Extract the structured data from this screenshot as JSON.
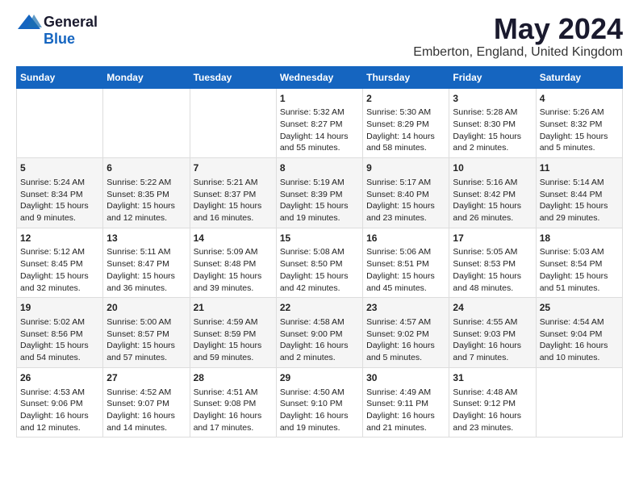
{
  "logo": {
    "general": "General",
    "blue": "Blue"
  },
  "title": "May 2024",
  "subtitle": "Emberton, England, United Kingdom",
  "days_of_week": [
    "Sunday",
    "Monday",
    "Tuesday",
    "Wednesday",
    "Thursday",
    "Friday",
    "Saturday"
  ],
  "weeks": [
    [
      {
        "day": "",
        "content": ""
      },
      {
        "day": "",
        "content": ""
      },
      {
        "day": "",
        "content": ""
      },
      {
        "day": "1",
        "content": "Sunrise: 5:32 AM\nSunset: 8:27 PM\nDaylight: 14 hours\nand 55 minutes."
      },
      {
        "day": "2",
        "content": "Sunrise: 5:30 AM\nSunset: 8:29 PM\nDaylight: 14 hours\nand 58 minutes."
      },
      {
        "day": "3",
        "content": "Sunrise: 5:28 AM\nSunset: 8:30 PM\nDaylight: 15 hours\nand 2 minutes."
      },
      {
        "day": "4",
        "content": "Sunrise: 5:26 AM\nSunset: 8:32 PM\nDaylight: 15 hours\nand 5 minutes."
      }
    ],
    [
      {
        "day": "5",
        "content": "Sunrise: 5:24 AM\nSunset: 8:34 PM\nDaylight: 15 hours\nand 9 minutes."
      },
      {
        "day": "6",
        "content": "Sunrise: 5:22 AM\nSunset: 8:35 PM\nDaylight: 15 hours\nand 12 minutes."
      },
      {
        "day": "7",
        "content": "Sunrise: 5:21 AM\nSunset: 8:37 PM\nDaylight: 15 hours\nand 16 minutes."
      },
      {
        "day": "8",
        "content": "Sunrise: 5:19 AM\nSunset: 8:39 PM\nDaylight: 15 hours\nand 19 minutes."
      },
      {
        "day": "9",
        "content": "Sunrise: 5:17 AM\nSunset: 8:40 PM\nDaylight: 15 hours\nand 23 minutes."
      },
      {
        "day": "10",
        "content": "Sunrise: 5:16 AM\nSunset: 8:42 PM\nDaylight: 15 hours\nand 26 minutes."
      },
      {
        "day": "11",
        "content": "Sunrise: 5:14 AM\nSunset: 8:44 PM\nDaylight: 15 hours\nand 29 minutes."
      }
    ],
    [
      {
        "day": "12",
        "content": "Sunrise: 5:12 AM\nSunset: 8:45 PM\nDaylight: 15 hours\nand 32 minutes."
      },
      {
        "day": "13",
        "content": "Sunrise: 5:11 AM\nSunset: 8:47 PM\nDaylight: 15 hours\nand 36 minutes."
      },
      {
        "day": "14",
        "content": "Sunrise: 5:09 AM\nSunset: 8:48 PM\nDaylight: 15 hours\nand 39 minutes."
      },
      {
        "day": "15",
        "content": "Sunrise: 5:08 AM\nSunset: 8:50 PM\nDaylight: 15 hours\nand 42 minutes."
      },
      {
        "day": "16",
        "content": "Sunrise: 5:06 AM\nSunset: 8:51 PM\nDaylight: 15 hours\nand 45 minutes."
      },
      {
        "day": "17",
        "content": "Sunrise: 5:05 AM\nSunset: 8:53 PM\nDaylight: 15 hours\nand 48 minutes."
      },
      {
        "day": "18",
        "content": "Sunrise: 5:03 AM\nSunset: 8:54 PM\nDaylight: 15 hours\nand 51 minutes."
      }
    ],
    [
      {
        "day": "19",
        "content": "Sunrise: 5:02 AM\nSunset: 8:56 PM\nDaylight: 15 hours\nand 54 minutes."
      },
      {
        "day": "20",
        "content": "Sunrise: 5:00 AM\nSunset: 8:57 PM\nDaylight: 15 hours\nand 57 minutes."
      },
      {
        "day": "21",
        "content": "Sunrise: 4:59 AM\nSunset: 8:59 PM\nDaylight: 15 hours\nand 59 minutes."
      },
      {
        "day": "22",
        "content": "Sunrise: 4:58 AM\nSunset: 9:00 PM\nDaylight: 16 hours\nand 2 minutes."
      },
      {
        "day": "23",
        "content": "Sunrise: 4:57 AM\nSunset: 9:02 PM\nDaylight: 16 hours\nand 5 minutes."
      },
      {
        "day": "24",
        "content": "Sunrise: 4:55 AM\nSunset: 9:03 PM\nDaylight: 16 hours\nand 7 minutes."
      },
      {
        "day": "25",
        "content": "Sunrise: 4:54 AM\nSunset: 9:04 PM\nDaylight: 16 hours\nand 10 minutes."
      }
    ],
    [
      {
        "day": "26",
        "content": "Sunrise: 4:53 AM\nSunset: 9:06 PM\nDaylight: 16 hours\nand 12 minutes."
      },
      {
        "day": "27",
        "content": "Sunrise: 4:52 AM\nSunset: 9:07 PM\nDaylight: 16 hours\nand 14 minutes."
      },
      {
        "day": "28",
        "content": "Sunrise: 4:51 AM\nSunset: 9:08 PM\nDaylight: 16 hours\nand 17 minutes."
      },
      {
        "day": "29",
        "content": "Sunrise: 4:50 AM\nSunset: 9:10 PM\nDaylight: 16 hours\nand 19 minutes."
      },
      {
        "day": "30",
        "content": "Sunrise: 4:49 AM\nSunset: 9:11 PM\nDaylight: 16 hours\nand 21 minutes."
      },
      {
        "day": "31",
        "content": "Sunrise: 4:48 AM\nSunset: 9:12 PM\nDaylight: 16 hours\nand 23 minutes."
      },
      {
        "day": "",
        "content": ""
      }
    ]
  ]
}
